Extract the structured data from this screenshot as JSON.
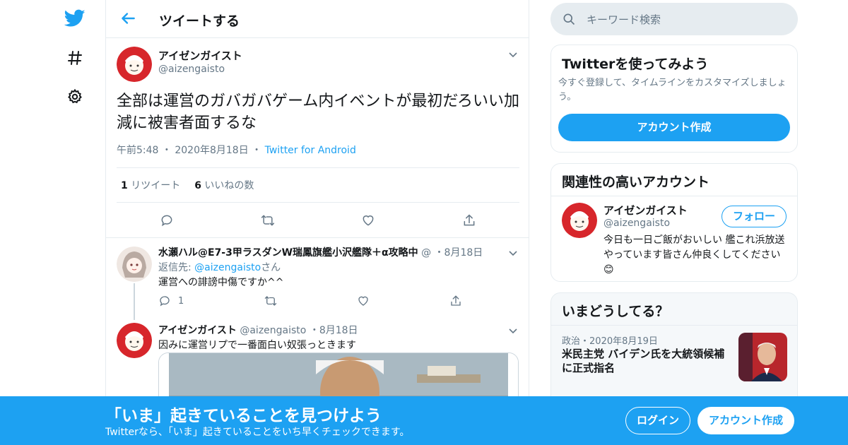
{
  "header": {
    "title": "ツイートする"
  },
  "main_tweet": {
    "name": "アイゼンガイスト",
    "handle": "@aizengaisto",
    "text": "全部は運営のガバガバゲーム内イベントが最初だろいい加減に被害者面するな",
    "time": "午前5:48",
    "date": "2020年8月18日",
    "source": "Twitter for Android",
    "retweets_count": "1",
    "retweets_label": "リツイート",
    "likes_count": "6",
    "likes_label": "いいねの数"
  },
  "replies": [
    {
      "name": "水瀬ハル@E7-3甲ラスダンW瑞鳳旗艦小沢艦隊＋α攻略中",
      "handle": "@",
      "date": "8月18日",
      "reply_to_prefix": "返信先: ",
      "reply_to_handle": "@aizengaisto",
      "reply_to_suffix": "さん",
      "text": "運営への誹謗中傷ですか^^",
      "reply_count": "1"
    },
    {
      "name": "アイゼンガイスト",
      "handle": "@aizengaisto",
      "date": "8月18日",
      "text": "因みに運営リプで一番面白い奴張っときます"
    }
  ],
  "sidebar": {
    "search_placeholder": "キーワード検索",
    "signup_card": {
      "title": "Twitterを使ってみよう",
      "desc": "今すぐ登録して、タイムラインをカスタマイズしましょう。",
      "button": "アカウント作成"
    },
    "relevant": {
      "title": "関連性の高いアカウント",
      "name": "アイゼンガイスト",
      "handle": "@aizengaisto",
      "follow": "フォロー",
      "bio": "今日も一日ご飯がおいしい 艦これ浜放送やっています皆さん仲良くしてください😊"
    },
    "trends": {
      "title": "いまどうしてる？",
      "category": "政治",
      "date": "2020年8月19日",
      "headline": "米民主党 バイデン氏を大統領候補に正式指名"
    }
  },
  "banner": {
    "title": "「いま」起きていることを見つけよう",
    "subtitle": "Twitterなら、「いま」起きていることをいち早くチェックできます。",
    "login": "ログイン",
    "signup": "アカウント作成"
  },
  "colors": {
    "accent": "#1da1f2",
    "border": "#e6ecf0",
    "muted": "#657786"
  }
}
